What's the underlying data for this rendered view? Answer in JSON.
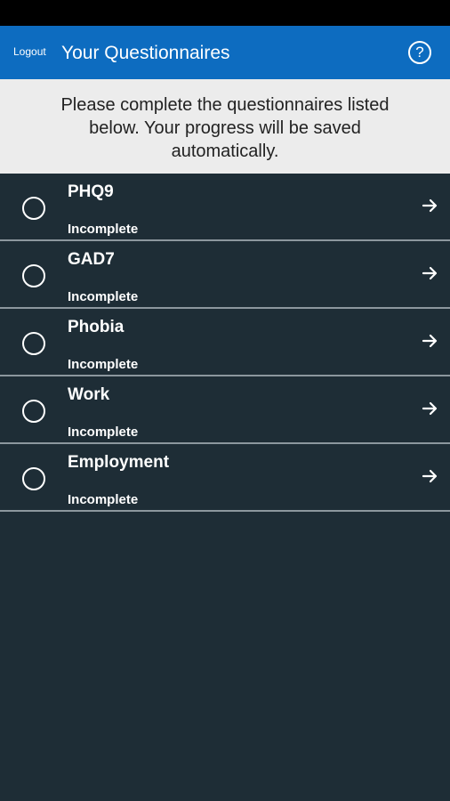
{
  "header": {
    "logout_label": "Logout",
    "title": "Your Questionnaires",
    "help_icon": "help-circle-icon",
    "help_glyph": "?"
  },
  "notice": {
    "text": "Please complete the questionnaires listed below. Your progress will be saved automatically."
  },
  "questionnaires": [
    {
      "title": "PHQ9",
      "status": "Incomplete"
    },
    {
      "title": "GAD7",
      "status": "Incomplete"
    },
    {
      "title": "Phobia",
      "status": "Incomplete"
    },
    {
      "title": "Work",
      "status": "Incomplete"
    },
    {
      "title": "Employment",
      "status": "Incomplete"
    }
  ],
  "icons": {
    "row_leading": "radio-unchecked-icon",
    "row_trailing": "arrow-right-icon"
  },
  "colors": {
    "app_bar": "#0d6cc0",
    "background": "#1e2d36",
    "notice_background": "#ececec"
  }
}
